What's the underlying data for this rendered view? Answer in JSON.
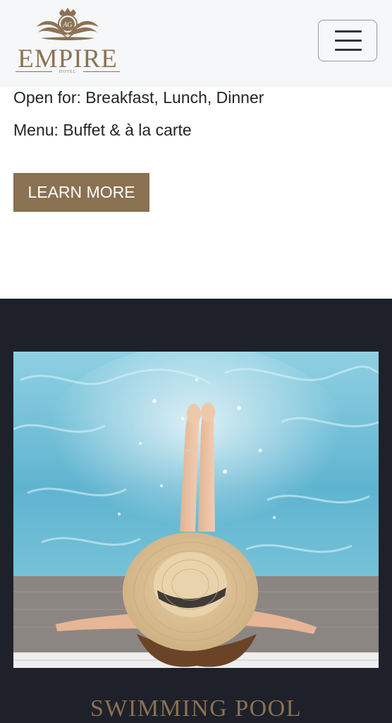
{
  "header": {
    "logo": {
      "monogram": "AG",
      "wordmark": "EMPIRE",
      "subtitle": "HOTEL"
    },
    "menu_button": {
      "icon": "hamburger-icon"
    }
  },
  "restaurant": {
    "open_for": "Open for: Breakfast, Lunch, Dinner",
    "menu": "Menu: Buffet & à la carte",
    "cta_label": "LEARN MORE"
  },
  "pool_section": {
    "title": "SWIMMING POOL",
    "photo_subject": "woman-in-sun-hat-by-pool"
  },
  "colors": {
    "brand_gold": "#8a7152",
    "dark_bg": "#1e212a",
    "header_bg": "#f6f7f9"
  }
}
